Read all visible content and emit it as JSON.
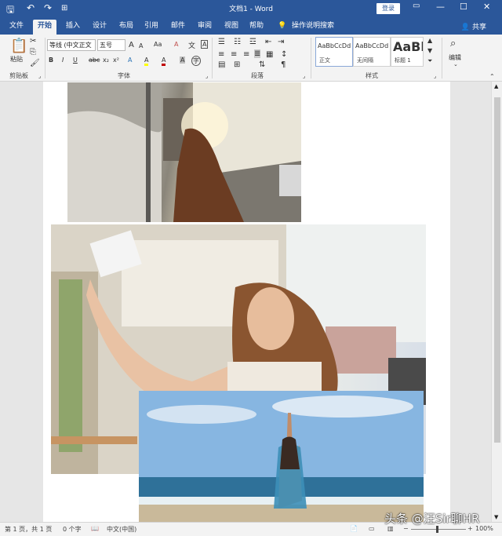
{
  "window": {
    "title": "文档1 - Word",
    "login_label": "登录",
    "minimize": "—",
    "restore": "☐",
    "close": "✕"
  },
  "tabs": [
    {
      "label": "文件"
    },
    {
      "label": "开始"
    },
    {
      "label": "插入"
    },
    {
      "label": "设计"
    },
    {
      "label": "布局"
    },
    {
      "label": "引用"
    },
    {
      "label": "邮件"
    },
    {
      "label": "审阅"
    },
    {
      "label": "视图"
    },
    {
      "label": "帮助"
    }
  ],
  "tell_me": "操作说明搜索",
  "share": "共享",
  "ribbon": {
    "clipboard": {
      "paste": "粘贴",
      "group": "剪贴板"
    },
    "font": {
      "name": "等线 (中文正文",
      "size": "五号",
      "group": "字体",
      "bold": "B",
      "italic": "I",
      "underline": "U",
      "strike": "abc",
      "sub": "x₂",
      "sup": "x²",
      "grow": "A",
      "shrink": "A",
      "case": "Aa",
      "clear": "A",
      "highlight": "A",
      "color": "A",
      "shade": "A",
      "circle": "字"
    },
    "paragraph": {
      "group": "段落"
    },
    "styles": {
      "group": "样式",
      "items": [
        {
          "sample": "AaBbCcDd",
          "name": "正文"
        },
        {
          "sample": "AaBbCcDd",
          "name": "无间隔"
        },
        {
          "sample": "AaBl",
          "name": "标题 1"
        }
      ]
    },
    "editing": {
      "label": "编辑"
    }
  },
  "statusbar": {
    "page": "第 1 页，共 1 页",
    "words": "0 个字",
    "language": "中文(中国)",
    "zoom": "100%"
  },
  "watermark": "头条 @汪Sir聊HR",
  "colors": {
    "accent": "#2b579a",
    "font_color": "#c00000",
    "highlight": "#ffff00"
  }
}
